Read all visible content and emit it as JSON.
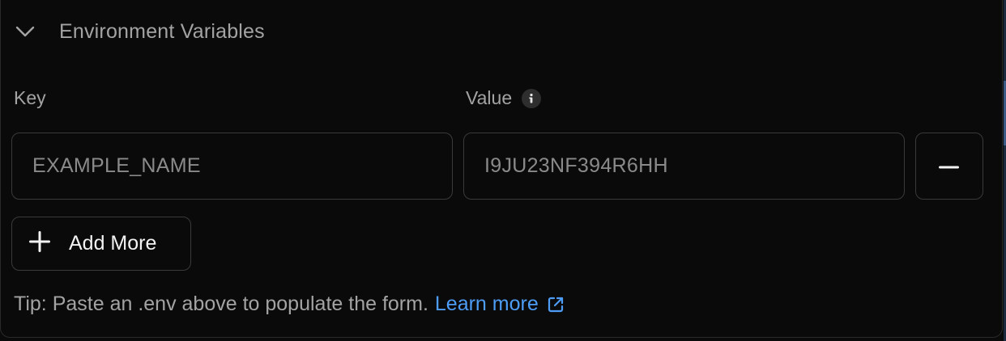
{
  "section": {
    "title": "Environment Variables",
    "toggle_icon": "chevron-down-icon"
  },
  "columns": {
    "key_label": "Key",
    "value_label": "Value",
    "value_info_icon": "info-icon"
  },
  "rows": [
    {
      "key_placeholder": "EXAMPLE_NAME",
      "value_placeholder": "I9JU23NF394R6HH",
      "remove_icon": "minus-icon"
    }
  ],
  "add_button": {
    "label": "Add More",
    "icon": "plus-icon"
  },
  "tip": {
    "text": "Tip: Paste an .env above to populate the form.",
    "link_label": "Learn more",
    "link_icon": "external-link-icon"
  },
  "colors": {
    "background": "#0b0a0a",
    "border": "#3a3a3a",
    "muted_text": "#a3a3a3",
    "link": "#4d9cf5",
    "primary_text": "#f2f2f2"
  }
}
